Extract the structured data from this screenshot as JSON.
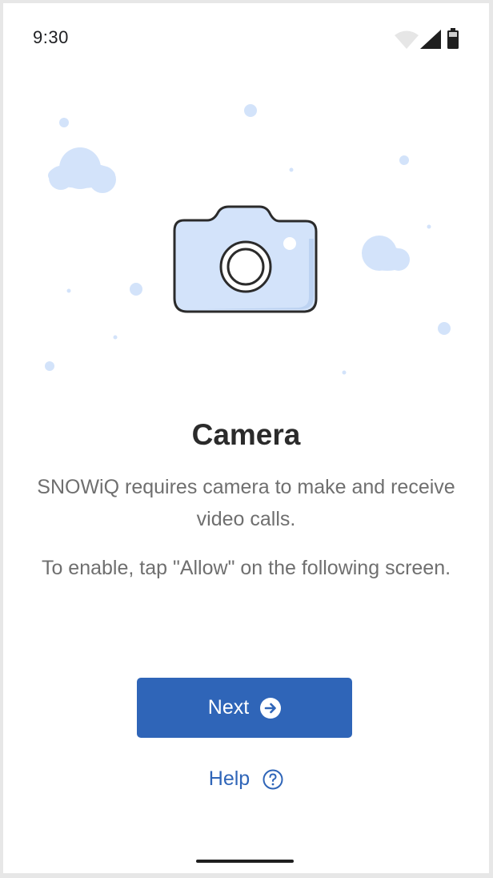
{
  "status_bar": {
    "time": "9:30",
    "icons": [
      "wifi-icon",
      "cell-signal-icon",
      "battery-icon"
    ]
  },
  "illustration": {
    "icon": "camera-icon"
  },
  "content": {
    "title": "Camera",
    "description": "SNOWiQ requires camera to make and receive video calls.",
    "instruction": "To enable, tap \"Allow\" on the following screen."
  },
  "actions": {
    "next_label": "Next",
    "next_icon": "arrow-right-circle-icon",
    "help_label": "Help",
    "help_icon": "question-circle-icon"
  },
  "colors": {
    "primary": "#2f65b8",
    "illustration_fill": "#d3e3fa",
    "text_dark": "#2b2b2b",
    "text_muted": "#6f6f6f"
  }
}
